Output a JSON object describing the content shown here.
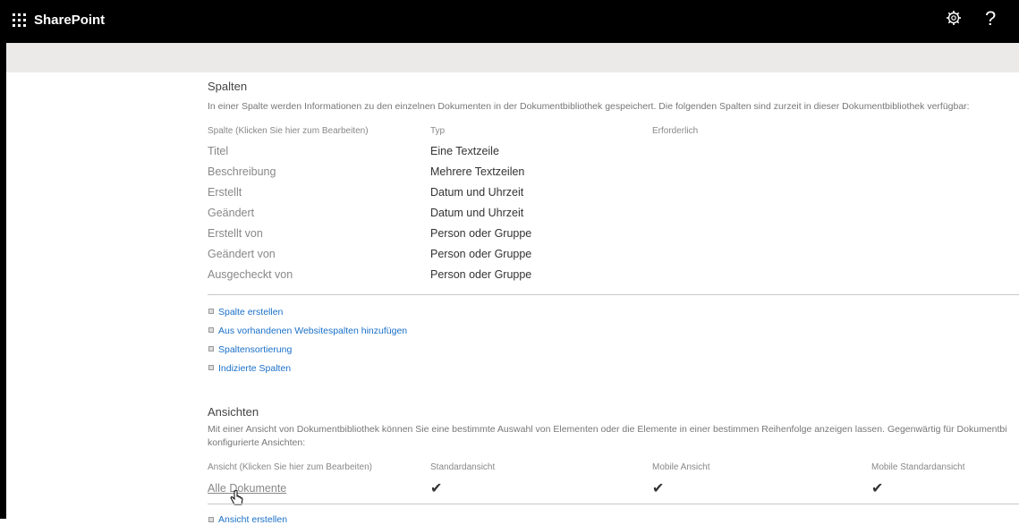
{
  "topbar": {
    "brand": "SharePoint",
    "settings_icon": "gear-icon",
    "help_icon": "help-icon",
    "help_glyph": "?"
  },
  "columns_section": {
    "title": "Spalten",
    "description": "In einer Spalte werden Informationen zu den einzelnen Dokumenten in der Dokumentbibliothek gespeichert. Die folgenden Spalten sind zurzeit in dieser Dokumentbibliothek verfügbar:",
    "headers": {
      "column": "Spalte (Klicken Sie hier zum Bearbeiten)",
      "type": "Typ",
      "required": "Erforderlich"
    },
    "rows": [
      {
        "name": "Titel",
        "type": "Eine Textzeile"
      },
      {
        "name": "Beschreibung",
        "type": "Mehrere Textzeilen"
      },
      {
        "name": "Erstellt",
        "type": "Datum und Uhrzeit"
      },
      {
        "name": "Geändert",
        "type": "Datum und Uhrzeit"
      },
      {
        "name": "Erstellt von",
        "type": "Person oder Gruppe"
      },
      {
        "name": "Geändert von",
        "type": "Person oder Gruppe"
      },
      {
        "name": "Ausgecheckt von",
        "type": "Person oder Gruppe"
      }
    ],
    "links": [
      "Spalte erstellen",
      "Aus vorhandenen Websitespalten hinzufügen",
      "Spaltensortierung",
      "Indizierte Spalten"
    ]
  },
  "views_section": {
    "title": "Ansichten",
    "description_line1": "Mit einer Ansicht von Dokumentbibliothek können Sie eine bestimmte Auswahl von Elementen oder die Elemente in einer bestimmen Reihenfolge anzeigen lassen. Gegenwärtig für Dokumentbi",
    "description_line2": "konfigurierte Ansichten:",
    "headers": {
      "view": "Ansicht (Klicken Sie hier zum Bearbeiten)",
      "default": "Standardansicht",
      "mobile": "Mobile Ansicht",
      "mobile_default": "Mobile Standardansicht"
    },
    "rows": [
      {
        "name": "Alle Dokumente",
        "default": "✔",
        "mobile": "✔",
        "mobile_default": "✔"
      }
    ],
    "link": "Ansicht erstellen"
  }
}
